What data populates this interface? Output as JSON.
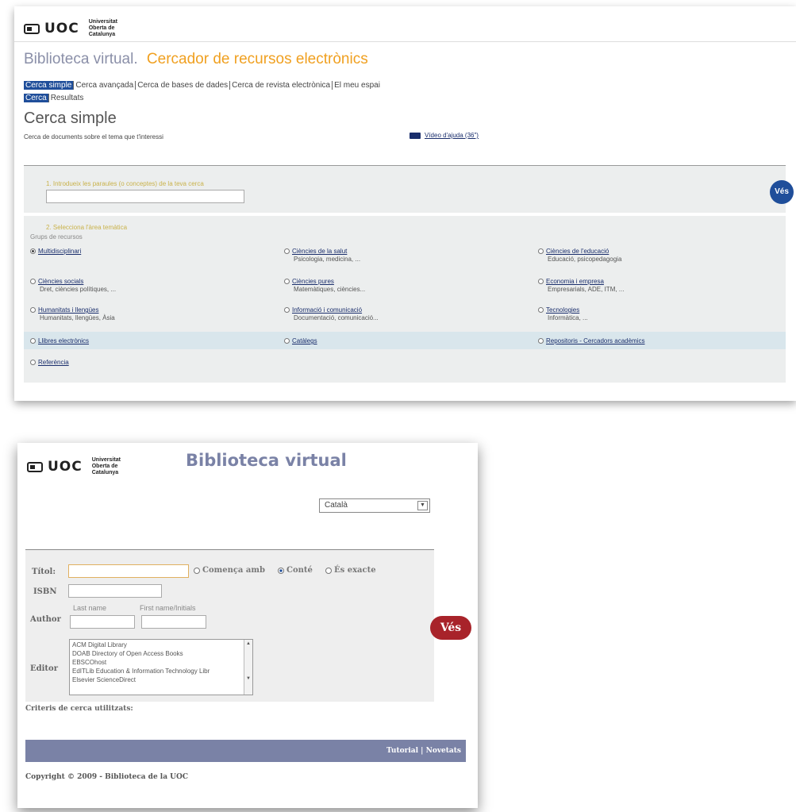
{
  "top": {
    "logo_text": "UOC",
    "logo_sub": "Universitat Oberta de Catalunya",
    "title": "Biblioteca virtual.",
    "subtitle": "Cercador de recursos electrònics",
    "tabs": [
      "Cerca simple",
      "Cerca avançada",
      "Cerca de bases de dades",
      "Cerca de revista electrònica",
      "El meu espai"
    ],
    "subtabs": [
      "Cerca",
      "Resultats"
    ],
    "heading": "Cerca simple",
    "description": "Cerca de documents sobre el tema que t'interessi",
    "video_link": "Vídeo d'ajuda (36\")",
    "step1_label": "1. Introdueix les paraules (o conceptes) de la teva cerca",
    "go_button": "Vés",
    "step2_label": "2. Selecciona l'àrea temàtica",
    "group_label": "Grups de recursos",
    "options": [
      {
        "name": "Multidisciplinari",
        "desc": "",
        "selected": true
      },
      {
        "name": "Ciències de la salut",
        "desc": "Psicologia, medicina, ..."
      },
      {
        "name": "Ciències de l'educació",
        "desc": "Educació, psicopedagogia"
      },
      {
        "name": "Ciències socials",
        "desc": "Dret, ciències polítiques, ..."
      },
      {
        "name": "Ciències pures",
        "desc": "Matemàtiques, ciències..."
      },
      {
        "name": "Economia i empresa",
        "desc": "Empresarials, ADE, ITM, ..."
      },
      {
        "name": "Humanitats i llengües",
        "desc": "Humanitats, llengües, Àsia"
      },
      {
        "name": "Informació i comunicació",
        "desc": "Documentació, comunicació..."
      },
      {
        "name": "Tecnologies",
        "desc": "Informàtica, ..."
      },
      {
        "name": "Llibres electrònics",
        "desc": ""
      },
      {
        "name": "Catàlegs",
        "desc": ""
      },
      {
        "name": "Repositoris - Cercadors acadèmics",
        "desc": ""
      },
      {
        "name": "Referència",
        "desc": ""
      }
    ]
  },
  "bottom": {
    "title": "Biblioteca virtual",
    "language": "Català",
    "titol_label": "Títol:",
    "radios": [
      "Comença amb",
      "Conté",
      "És exacte"
    ],
    "isbn_label": "ISBN",
    "author_label": "Author",
    "last_name": "Last name",
    "first_name": "First name/Initials",
    "editor_label": "Editor",
    "editors": [
      "ACM Digital Library",
      "DOAB Directory of Open Access Books",
      "EBSCOhost",
      "EdITLib Education & Information Technology Libr",
      "Elsevier ScienceDirect"
    ],
    "go_button": "Vés",
    "criteris": "Criteris de cerca utilitzats:",
    "footer_links": [
      "Tutorial",
      "Novetats"
    ],
    "copyright": "Copyright © 2009 - Biblioteca de la UOC"
  },
  "colors": {
    "accent_blue": "#1f4e9a",
    "accent_orange": "#f0a020",
    "brand_purple": "#7a82a6",
    "button_red": "#a8232a"
  }
}
